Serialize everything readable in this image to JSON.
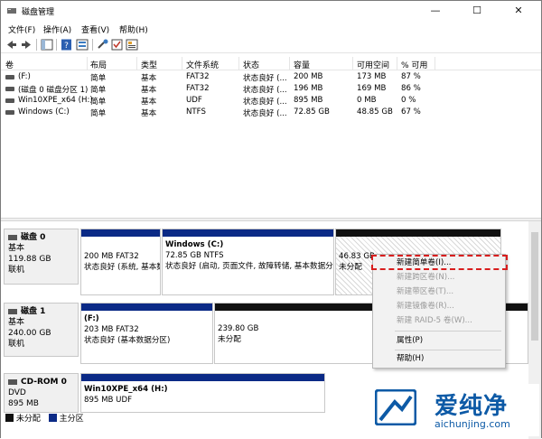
{
  "window": {
    "title": "磁盘管理",
    "minimize": "—",
    "maximize": "☐",
    "close": "✕"
  },
  "menu": [
    "文件(F)",
    "操作(A)",
    "查看(V)",
    "帮助(H)"
  ],
  "volumes": {
    "headers": [
      "卷",
      "布局",
      "类型",
      "文件系统",
      "状态",
      "容量",
      "可用空间",
      "% 可用"
    ],
    "rows": [
      [
        "(F:)",
        "简单",
        "基本",
        "FAT32",
        "状态良好 (...",
        "200 MB",
        "173 MB",
        "87 %"
      ],
      [
        "(磁盘 0 磁盘分区 1)",
        "简单",
        "基本",
        "FAT32",
        "状态良好 (...",
        "196 MB",
        "169 MB",
        "86 %"
      ],
      [
        "Win10XPE_x64 (H:)",
        "简单",
        "基本",
        "UDF",
        "状态良好 (...",
        "895 MB",
        "0 MB",
        "0 %"
      ],
      [
        "Windows (C:)",
        "简单",
        "基本",
        "NTFS",
        "状态良好 (...",
        "72.85 GB",
        "48.85 GB",
        "67 %"
      ]
    ]
  },
  "disks": [
    {
      "name": "磁盘 0",
      "type": "基本",
      "size": "119.88 GB",
      "status": "联机",
      "partitions": [
        {
          "label": "",
          "line1": "200 MB FAT32",
          "line2": "状态良好 (系统, 基本数"
        },
        {
          "label": "Windows  (C:)",
          "line1": "72.85 GB NTFS",
          "line2": "状态良好 (启动, 页面文件, 故障转储, 基本数据分"
        },
        {
          "label": "",
          "line1": "46.83 GB",
          "line2": "未分配"
        }
      ]
    },
    {
      "name": "磁盘 1",
      "type": "基本",
      "size": "240.00 GB",
      "status": "联机",
      "partitions": [
        {
          "label": "(F:)",
          "line1": "203 MB FAT32",
          "line2": "状态良好 (基本数据分区)"
        },
        {
          "label": "",
          "line1": "239.80 GB",
          "line2": "未分配"
        }
      ]
    },
    {
      "name": "CD-ROM 0",
      "type": "DVD",
      "size": "895 MB",
      "status": "联机",
      "partitions": [
        {
          "label": "Win10XPE_x64  (H:)",
          "line1": "895 MB UDF",
          "line2": ""
        }
      ]
    }
  ],
  "legend": [
    {
      "label": "未分配",
      "color": "#111111"
    },
    {
      "label": "主分区",
      "color": "#0b2a86"
    }
  ],
  "context_menu": {
    "items": [
      {
        "label": "新建简单卷(I)...",
        "enabled": true
      },
      {
        "label": "新建跨区卷(N)...",
        "enabled": false
      },
      {
        "label": "新建带区卷(T)...",
        "enabled": false
      },
      {
        "label": "新建镜像卷(R)...",
        "enabled": false
      },
      {
        "label": "新建 RAID-5 卷(W)...",
        "enabled": false
      },
      {
        "label": "属性(P)",
        "enabled": true
      },
      {
        "label": "帮助(H)",
        "enabled": true
      }
    ]
  },
  "watermark": {
    "brand": "爱纯净",
    "url": "aichunjing.com",
    "color": "#0d5aa6"
  }
}
